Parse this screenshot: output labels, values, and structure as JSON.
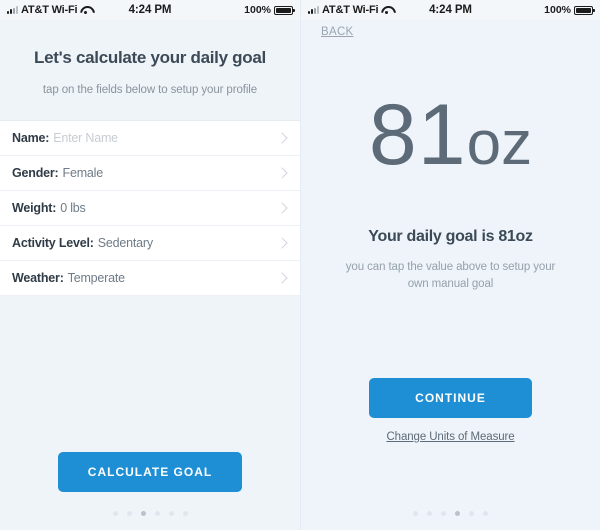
{
  "status_bar": {
    "carrier": "AT&T Wi-Fi",
    "time": "4:24 PM",
    "battery_percent": "100%",
    "signal_icon": "signal-bars-icon",
    "wifi_icon": "wifi-icon",
    "battery_icon": "battery-full-icon"
  },
  "colors": {
    "accent": "#1e8fd5",
    "page_bg": "#eff4f9",
    "card_bg": "#ffffff",
    "heading": "#3c4a57",
    "muted": "#8a949d",
    "big_value": "#5d6a77"
  },
  "left_screen": {
    "heading": "Let's calculate your daily goal",
    "subheading": "tap on the fields below to setup your profile",
    "fields": [
      {
        "label": "Name:",
        "value": "Enter Name",
        "is_placeholder": true,
        "chevron": "chevron-right-icon"
      },
      {
        "label": "Gender:",
        "value": "Female",
        "is_placeholder": false,
        "chevron": "chevron-right-icon"
      },
      {
        "label": "Weight:",
        "value": "0 lbs",
        "is_placeholder": false,
        "chevron": "chevron-right-icon"
      },
      {
        "label": "Activity Level:",
        "value": "Sedentary",
        "is_placeholder": false,
        "chevron": "chevron-right-icon"
      },
      {
        "label": "Weather:",
        "value": "Temperate",
        "is_placeholder": false,
        "chevron": "chevron-right-icon"
      }
    ],
    "primary_button": "CALCULATE GOAL",
    "pagination": {
      "total": 6,
      "active_index": 2
    }
  },
  "right_screen": {
    "back_label": "BACK",
    "big_value_number": "81",
    "big_value_unit": "oz",
    "goal_text": "Your daily goal is 81oz",
    "goal_hint": "you can tap the value above to setup your own manual goal",
    "primary_button": "CONTINUE",
    "units_link": "Change Units of Measure",
    "pagination": {
      "total": 6,
      "active_index": 3
    }
  }
}
